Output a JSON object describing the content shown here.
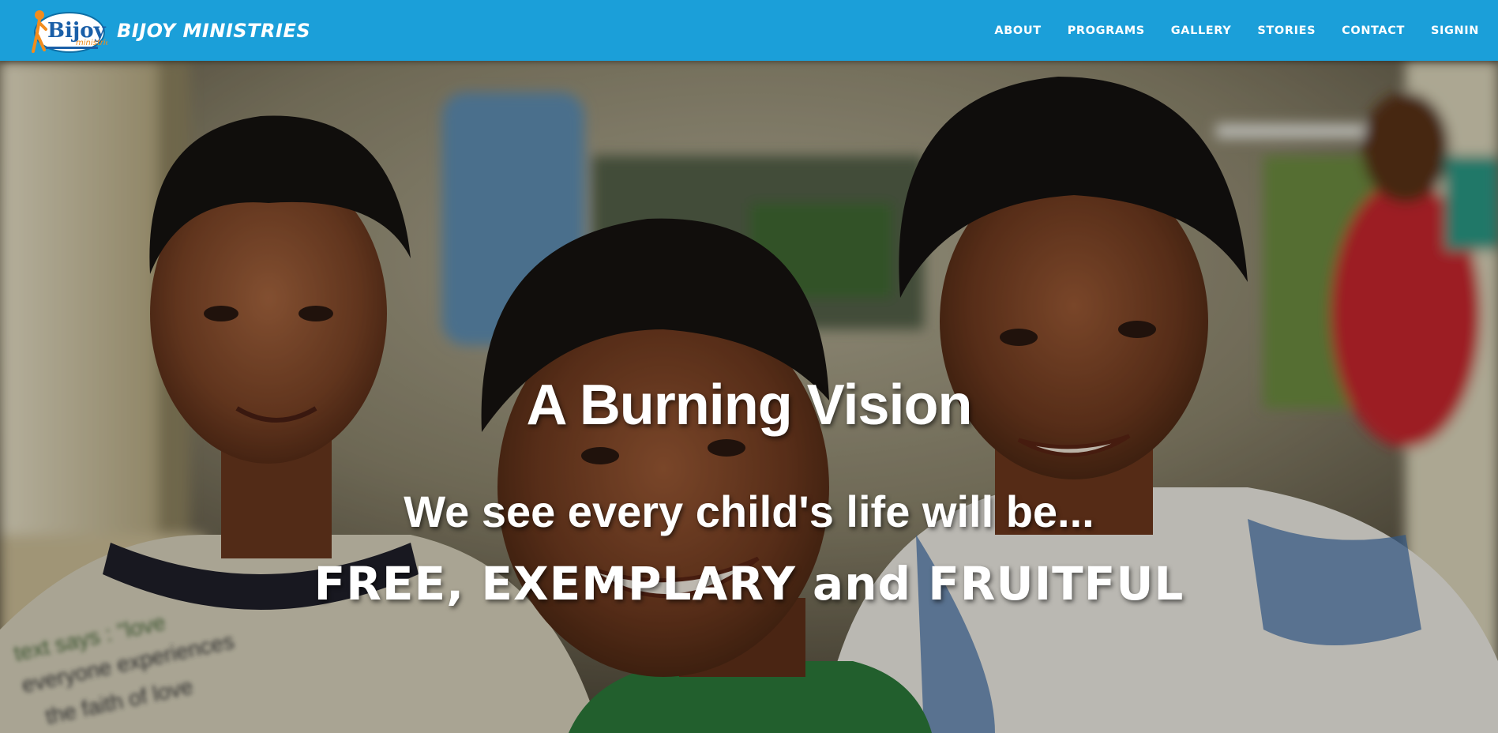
{
  "brand": {
    "logo_name": "bijoy-ministries-logo",
    "logo_text": "Bijoy",
    "name": "BIJOY MINISTRIES"
  },
  "nav": {
    "items": [
      {
        "label": "ABOUT"
      },
      {
        "label": "PROGRAMS"
      },
      {
        "label": "GALLERY"
      },
      {
        "label": "STORIES"
      },
      {
        "label": "CONTACT"
      },
      {
        "label": "SIGNIN"
      }
    ]
  },
  "hero": {
    "title": "A Burning Vision",
    "subtitle": "We see every child's life will be...",
    "tagline": "FREE, EXEMPLARY and FRUITFUL",
    "image_subject": "photo of three smiling boys"
  },
  "colors": {
    "navbar": "#1b9fd9",
    "text": "#ffffff"
  }
}
